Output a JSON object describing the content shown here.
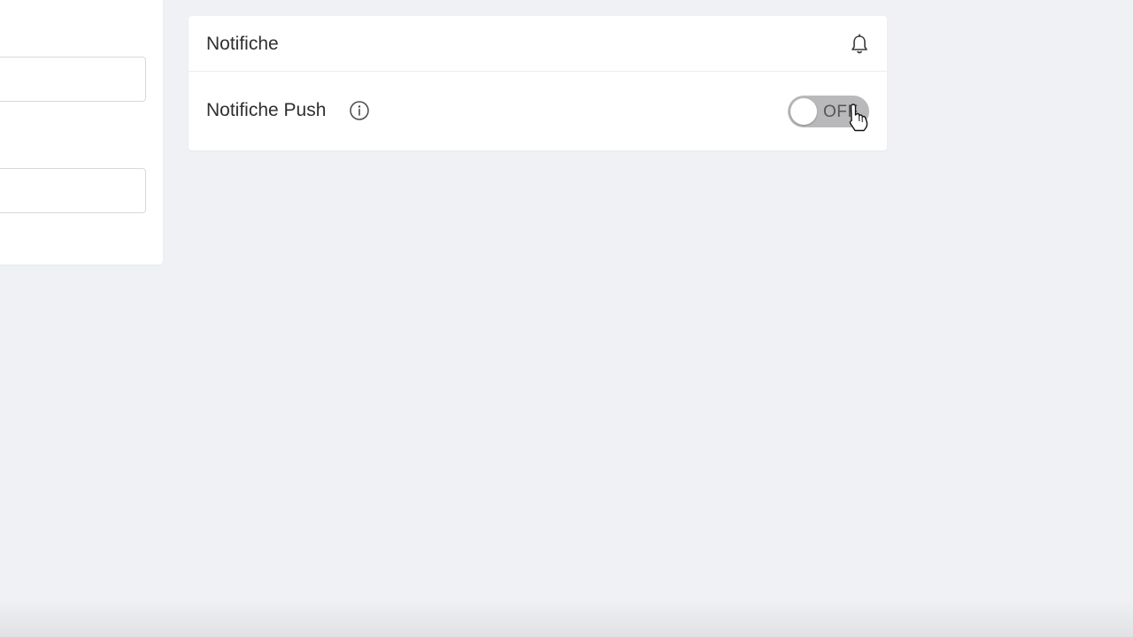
{
  "notifications_card": {
    "title": "Notifiche",
    "icon": "bell-icon",
    "push": {
      "label": "Notifiche Push",
      "info_icon": "info-icon",
      "toggle_state": "OFF"
    }
  },
  "colors": {
    "background": "#f0f1f4",
    "card": "#ffffff",
    "toggle_off": "#b9b9bb"
  }
}
